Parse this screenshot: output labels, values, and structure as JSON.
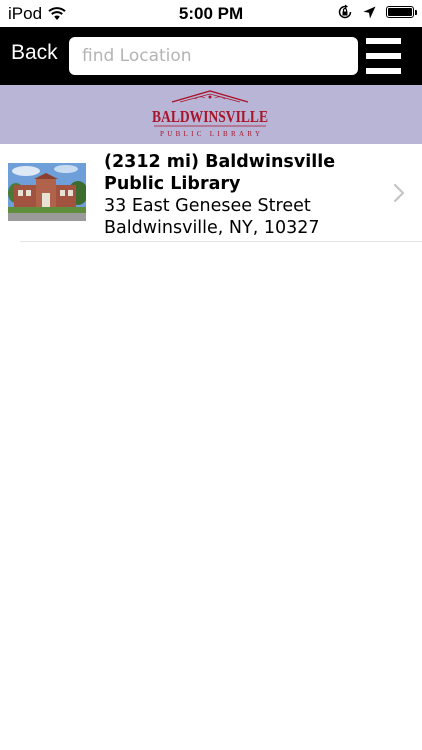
{
  "status_bar": {
    "carrier": "iPod",
    "time": "5:00 PM",
    "icons": [
      "wifi-icon",
      "orientation-lock-icon",
      "location-arrow-icon",
      "battery-icon"
    ]
  },
  "nav_bar": {
    "back_label": "Back",
    "search_placeholder": "find Location",
    "search_value": "",
    "menu_icon": "hamburger-menu-icon"
  },
  "banner": {
    "logo_text": "BALDWINSVILLE",
    "logo_subtext": "PUBLIC LIBRARY",
    "background_color": "#b9b5d6",
    "logo_color": "#a8142a"
  },
  "locations": [
    {
      "title_line1": "(2312 mi) Baldwinsville",
      "title_line2": "Public Library",
      "address_line1": "33 East Genesee Street",
      "address_line2": "Baldwinsville, NY, 10327",
      "thumbnail": "library-building-photo"
    }
  ]
}
